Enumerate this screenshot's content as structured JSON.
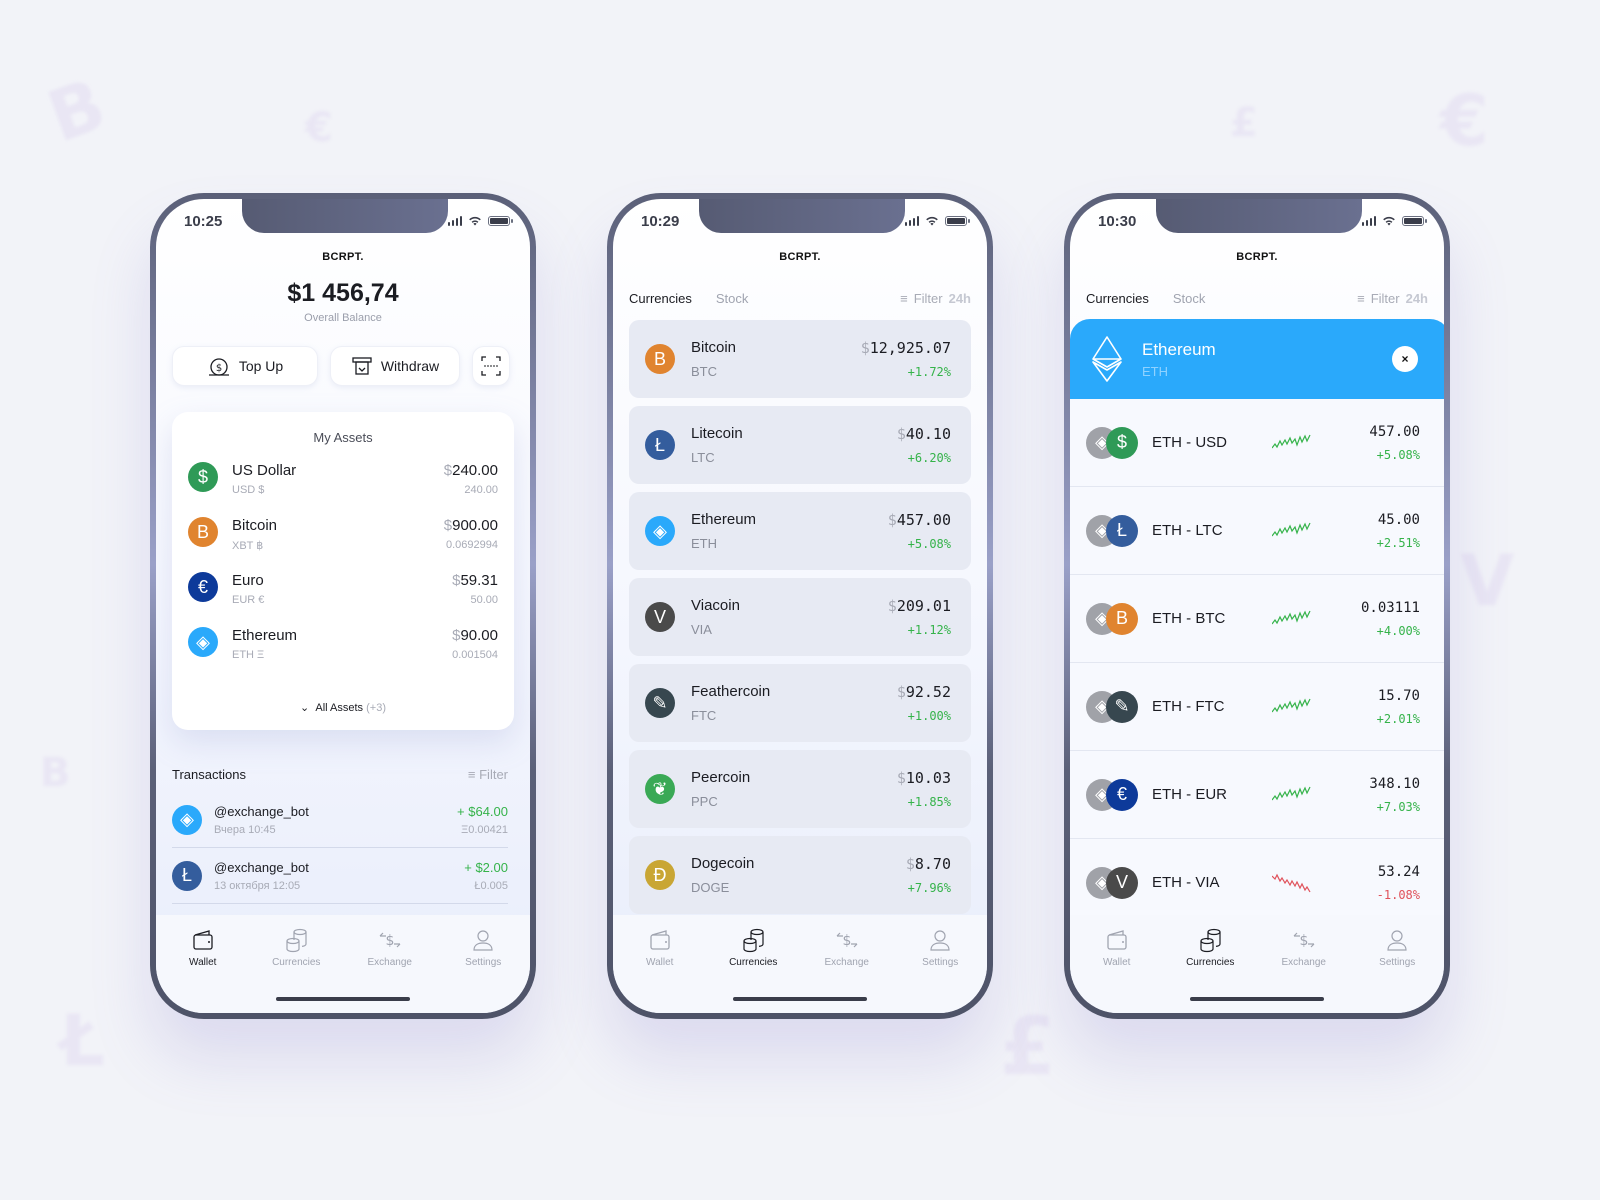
{
  "colors": {
    "background": "#f2f3f8",
    "accent_blue": "#2aa9fb",
    "positive": "#35b34a",
    "negative": "#e0525b",
    "usd": "#2f9a57",
    "btc": "#e0842f",
    "eur": "#0d3a9a",
    "eth": "#2aa9fb",
    "ltc": "#345d9d",
    "via": "#4a4a4a",
    "ftc": "#37474f",
    "ppc": "#3aa955",
    "doge": "#c9a634"
  },
  "app": {
    "brand": "BCRPT."
  },
  "tabs": [
    {
      "label": "Wallet",
      "icon": "wallet-icon"
    },
    {
      "label": "Currencies",
      "icon": "coins-icon"
    },
    {
      "label": "Exchange",
      "icon": "exchange-icon"
    },
    {
      "label": "Settings",
      "icon": "user-icon"
    }
  ],
  "wallet_screen": {
    "time": "10:25",
    "balance": "$1 456,74",
    "balance_label": "Overall Balance",
    "actions": {
      "top_up": "Top Up",
      "withdraw": "Withdraw"
    },
    "assets_title": "My Assets",
    "assets": [
      {
        "name": "US Dollar",
        "sub": "USD $",
        "usd_symbol": "$",
        "usd_value": "240.00",
        "amount": "240.00",
        "icon": "$"
      },
      {
        "name": "Bitcoin",
        "sub": "XBT ฿",
        "usd_symbol": "$",
        "usd_value": "900.00",
        "amount": "0.0692994",
        "icon": "B"
      },
      {
        "name": "Euro",
        "sub": "EUR €",
        "usd_symbol": "$",
        "usd_value": "59.31",
        "amount": "50.00",
        "icon": "€"
      },
      {
        "name": "Ethereum",
        "sub": "ETH Ξ",
        "usd_symbol": "$",
        "usd_value": "90.00",
        "amount": "0.001504",
        "icon": "◈"
      }
    ],
    "all_assets_label": "All Assets",
    "all_assets_count": "(+3)",
    "transactions_title": "Transactions",
    "filter_label": "Filter",
    "transactions": [
      {
        "name": "@exchange_bot",
        "date": "Вчера  10:45",
        "amount": "+ $64.00",
        "coin_amount": "Ξ0.00421",
        "icon": "◈"
      },
      {
        "name": "@exchange_bot",
        "date": "13 октября  12:05",
        "amount": "+ $2.00",
        "coin_amount": "Ł0.005",
        "icon": "Ł"
      }
    ]
  },
  "currencies_screen": {
    "time": "10:29",
    "segments": [
      "Currencies",
      "Stock"
    ],
    "filter_label": "Filter",
    "period": "24h",
    "coins": [
      {
        "name": "Bitcoin",
        "symbol": "BTC",
        "price": "12,925.07",
        "change": "+1.72%",
        "icon": "B"
      },
      {
        "name": "Litecoin",
        "symbol": "LTC",
        "price": "40.10",
        "change": "+6.20%",
        "icon": "Ł"
      },
      {
        "name": "Ethereum",
        "symbol": "ETH",
        "price": "457.00",
        "change": "+5.08%",
        "icon": "◈"
      },
      {
        "name": "Viacoin",
        "symbol": "VIA",
        "price": "209.01",
        "change": "+1.12%",
        "icon": "V"
      },
      {
        "name": "Feathercoin",
        "symbol": "FTC",
        "price": "92.52",
        "change": "+1.00%",
        "icon": "✎"
      },
      {
        "name": "Peercoin",
        "symbol": "PPC",
        "price": "10.03",
        "change": "+1.85%",
        "icon": "❦"
      },
      {
        "name": "Dogecoin",
        "symbol": "DOGE",
        "price": "8.70",
        "change": "+7.96%",
        "icon": "Ð"
      }
    ],
    "currency_symbol": "$"
  },
  "detail_screen": {
    "time": "10:30",
    "segments": [
      "Currencies",
      "Stock"
    ],
    "filter_label": "Filter",
    "period": "24h",
    "selected": {
      "name": "Ethereum",
      "symbol": "ETH",
      "close": "×"
    },
    "pairs": [
      {
        "name": "ETH - USD",
        "value": "457.00",
        "change": "+5.08%",
        "trend": "up",
        "quote_icon": "$"
      },
      {
        "name": "ETH - LTC",
        "value": "45.00",
        "change": "+2.51%",
        "trend": "up",
        "quote_icon": "Ł"
      },
      {
        "name": "ETH - BTC",
        "value": "0.03111",
        "change": "+4.00%",
        "trend": "up",
        "quote_icon": "B"
      },
      {
        "name": "ETH - FTC",
        "value": "15.70",
        "change": "+2.01%",
        "trend": "up",
        "quote_icon": "✎"
      },
      {
        "name": "ETH - EUR",
        "value": "348.10",
        "change": "+7.03%",
        "trend": "up",
        "quote_icon": "€"
      },
      {
        "name": "ETH - VIA",
        "value": "53.24",
        "change": "-1.08%",
        "trend": "down",
        "quote_icon": "V"
      }
    ]
  }
}
